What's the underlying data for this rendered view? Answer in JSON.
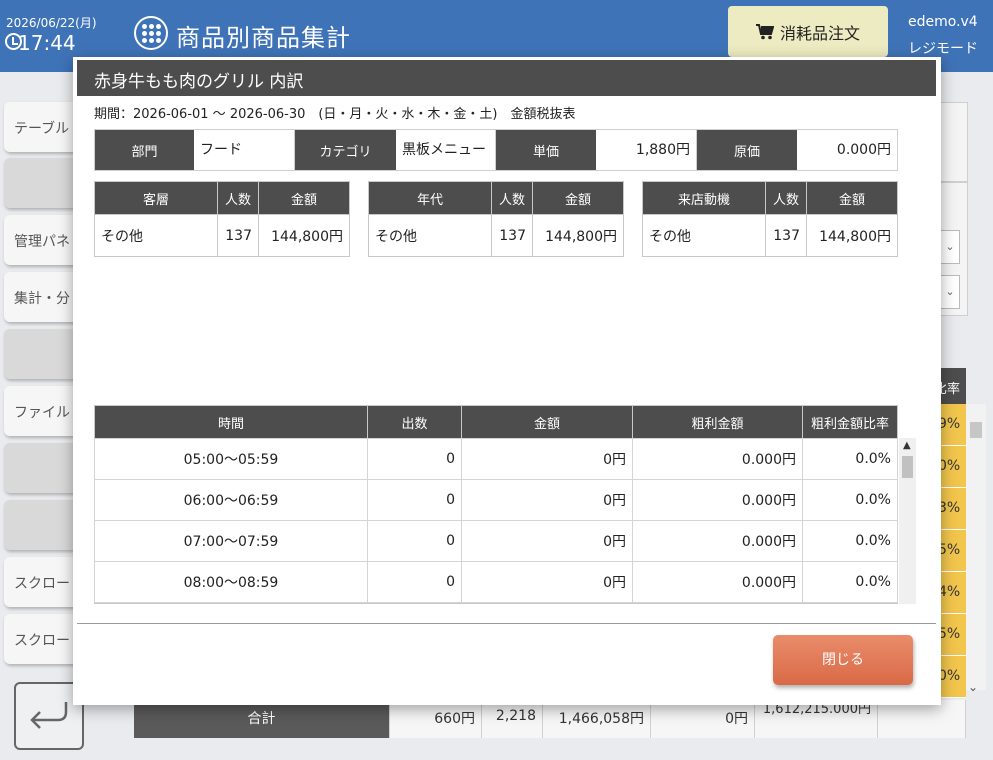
{
  "header": {
    "date": "2026/06/22(月)",
    "time": "17:44",
    "title": "商品別商品集計",
    "order_button": "消耗品注文",
    "user_name": "edemo.v4",
    "user_mode": "レジモード"
  },
  "sidebar": {
    "items": [
      {
        "label": "テーブル"
      },
      {
        "label": ""
      },
      {
        "label": "管理パネ"
      },
      {
        "label": "集計・分"
      },
      {
        "label": ""
      },
      {
        "label": "ファイル"
      },
      {
        "label": ""
      },
      {
        "label": ""
      },
      {
        "label": "スクロー"
      },
      {
        "label": "スクロー"
      }
    ]
  },
  "background": {
    "rate_header": "比率",
    "rate_cells": [
      "9%",
      "0%",
      "3%",
      "5%",
      "4%",
      "5%",
      "0%"
    ],
    "total_row": {
      "label": "合計",
      "values": [
        "660円",
        "2,218",
        "1,466,058円",
        "0円",
        "1,612,215.000円"
      ]
    }
  },
  "modal": {
    "title": "赤身牛もも肉のグリル 内訳",
    "period": "期間：2026-06-01 ～ 2026-06-30　(日・月・火・水・木・金・土)　金額税抜表",
    "info": {
      "department_label": "部門",
      "department_value": "フード",
      "category_label": "カテゴリ",
      "category_value": "黒板メニュー",
      "price_label": "単価",
      "price_value": "1,880円",
      "cost_label": "原価",
      "cost_value": "0.000円"
    },
    "breakdowns": [
      {
        "headers": [
          "客層",
          "人数",
          "金額"
        ],
        "rows": [
          [
            "その他",
            "137",
            "144,800円"
          ]
        ]
      },
      {
        "headers": [
          "年代",
          "人数",
          "金額"
        ],
        "rows": [
          [
            "その他",
            "137",
            "144,800円"
          ]
        ]
      },
      {
        "headers": [
          "来店動機",
          "人数",
          "金額"
        ],
        "rows": [
          [
            "その他",
            "137",
            "144,800円"
          ]
        ]
      }
    ],
    "time_table": {
      "headers": [
        "時間",
        "出数",
        "金額",
        "粗利金額",
        "粗利金額比率"
      ],
      "rows": [
        [
          "05:00～05:59",
          "0",
          "0円",
          "0.000円",
          "0.0%"
        ],
        [
          "06:00～06:59",
          "0",
          "0円",
          "0.000円",
          "0.0%"
        ],
        [
          "07:00～07:59",
          "0",
          "0円",
          "0.000円",
          "0.0%"
        ],
        [
          "08:00～08:59",
          "0",
          "0円",
          "0.000円",
          "0.0%"
        ]
      ]
    },
    "close_button": "閉じる"
  },
  "icons": {
    "clock": "clock-icon",
    "menu": "grid-menu-icon",
    "cart": "cart-icon",
    "back": "back-arrow-icon"
  },
  "colors": {
    "header_bg": "#3f73b8",
    "table_header": "#4d4d4d",
    "close_button": "#e07a56",
    "highlight": "#f2c64c",
    "order_button": "#ecebc1"
  }
}
